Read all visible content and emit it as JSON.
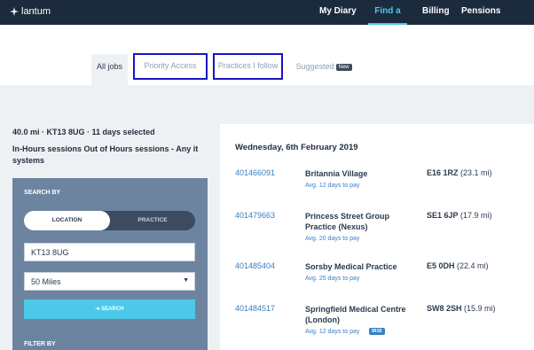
{
  "nav": {
    "logo": "lantum",
    "items": [
      {
        "label": "My Diary",
        "active": false
      },
      {
        "label": "Find a Job",
        "active": true
      },
      {
        "label": "Billing",
        "active": false
      },
      {
        "label": "Pensions",
        "active": false
      }
    ]
  },
  "tabs": [
    {
      "label": "All jobs",
      "active": true
    },
    {
      "label": "Priority Access",
      "active": false
    },
    {
      "label": "Practices I follow",
      "active": false
    },
    {
      "label": "Suggested",
      "badge": "New",
      "active": false
    }
  ],
  "filters": {
    "summary": "40.0 mi · KT13 8UG · 11 days selected",
    "sessions": "In-Hours sessions Out of Hours sessions - Any it systems"
  },
  "search_panel": {
    "heading": "SEARCH BY",
    "toggle": {
      "selected": "LOCATION",
      "other": "PRACTICE"
    },
    "location_value": "KT13 8UG",
    "distance_selected": "50 Miles",
    "search_button": "➜ SEARCH",
    "filter_heading": "FILTER BY"
  },
  "results": {
    "date": "Wednesday, 6th February 2019",
    "jobs": [
      {
        "id": "401466091",
        "practice": "Britannia Village",
        "pay": "Avg. 12 days to pay",
        "postcode": "E16 1RZ",
        "distance": "(23.1 mi)",
        "badge": ""
      },
      {
        "id": "401479663",
        "practice": "Princess Street Group Practice (Nexus)",
        "pay": "Avg. 20 days to pay",
        "postcode": "SE1 6JP",
        "distance": "(17.9 mi)",
        "badge": ""
      },
      {
        "id": "401485404",
        "practice": "Sorsby Medical Practice",
        "pay": "Avg. 25 days to pay",
        "postcode": "E5 0DH",
        "distance": "(22.4 mi)",
        "badge": ""
      },
      {
        "id": "401484517",
        "practice": "Springfield Medical Centre (London)",
        "pay": "Avg. 12 days to pay",
        "postcode": "SW8 2SH",
        "distance": "(15.9 mi)",
        "badge": "IR35"
      }
    ]
  }
}
